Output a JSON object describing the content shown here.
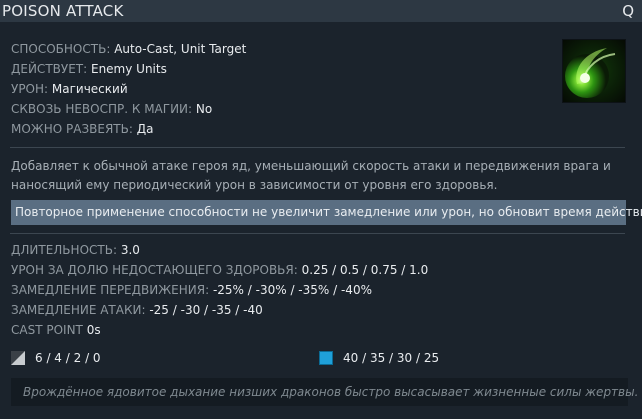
{
  "header": {
    "title": "POISON ATTACK",
    "hotkey": "Q"
  },
  "icon": {
    "name": "poison-attack-icon",
    "accent": "#5fe01f"
  },
  "properties": [
    {
      "label": "СПОСОБНОСТЬ:",
      "value": "Auto-Cast, Unit Target"
    },
    {
      "label": "ДЕЙСТВУЕТ:",
      "value": "Enemy Units"
    },
    {
      "label": "УРОН:",
      "value": "Магический"
    },
    {
      "label": "СКВОЗЬ НЕВОСПР. К МАГИИ:",
      "value": "No"
    },
    {
      "label": "МОЖНО РАЗВЕЯТЬ:",
      "value": "Да"
    }
  ],
  "description": "Добавляет к обычной атаке героя яд, уменьшающий скорость атаки и передвижения врага и наносящий ему периодический урон в зависимости от уровня его здоровья.",
  "note": "Повторное применение способности не увеличит замедление или урон, но обновит время действия.",
  "stats": [
    {
      "label": "ДЛИТЕЛЬНОСТЬ:",
      "value": "3.0"
    },
    {
      "label": "УРОН ЗА ДОЛЮ НЕДОСТАЮЩЕГО ЗДОРОВЬЯ:",
      "value": "0.25 / 0.5 / 0.75 / 1.0"
    },
    {
      "label": "ЗАМЕДЛЕНИЕ ПЕРЕДВИЖЕНИЯ:",
      "value": "-25% / -30% / -35% / -40%"
    },
    {
      "label": "ЗАМЕДЛЕНИЕ АТАКИ:",
      "value": "-25 / -30 / -35 / -40"
    },
    {
      "label": "CAST POINT",
      "value": "0s"
    }
  ],
  "costs": {
    "cooldown": "6 / 4 / 2 / 0",
    "mana": "40 / 35 / 30 / 25"
  },
  "lore": "Врождённое ядовитое дыхание низших драконов быстро высасывает жизненные силы жертвы.",
  "colors": {
    "background": "#1b232c",
    "header": "#2d3843",
    "note_background": "#5a6e82",
    "mana": "#1fa0d9"
  }
}
